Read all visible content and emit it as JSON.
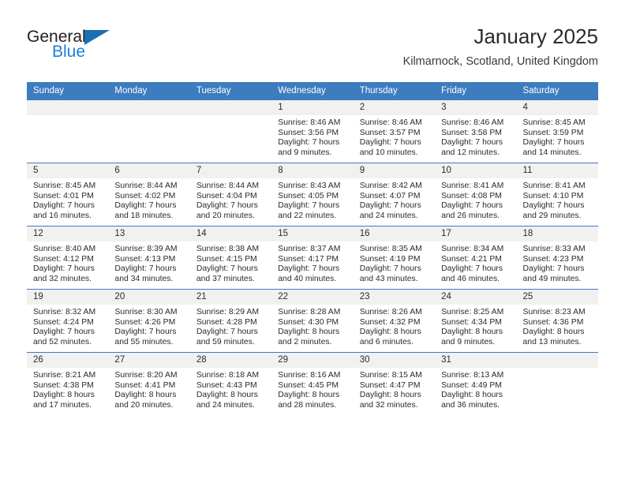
{
  "brand": {
    "line1": "General",
    "line2": "Blue",
    "triangle_color": "#1a6fb5",
    "blue_color": "#1a7fd4"
  },
  "header": {
    "title": "January 2025",
    "location": "Kilmarnock, Scotland, United Kingdom"
  },
  "theme": {
    "header_blue": "#3c7cbf",
    "daynum_band": "#f1f1f1",
    "text": "#2b2b2b"
  },
  "calendar": {
    "weekday_headers": [
      "Sunday",
      "Monday",
      "Tuesday",
      "Wednesday",
      "Thursday",
      "Friday",
      "Saturday"
    ],
    "weeks": [
      [
        {
          "day": "",
          "sunrise": "",
          "sunset": "",
          "daylight1": "",
          "daylight2": ""
        },
        {
          "day": "",
          "sunrise": "",
          "sunset": "",
          "daylight1": "",
          "daylight2": ""
        },
        {
          "day": "",
          "sunrise": "",
          "sunset": "",
          "daylight1": "",
          "daylight2": ""
        },
        {
          "day": "1",
          "sunrise": "Sunrise: 8:46 AM",
          "sunset": "Sunset: 3:56 PM",
          "daylight1": "Daylight: 7 hours",
          "daylight2": "and 9 minutes."
        },
        {
          "day": "2",
          "sunrise": "Sunrise: 8:46 AM",
          "sunset": "Sunset: 3:57 PM",
          "daylight1": "Daylight: 7 hours",
          "daylight2": "and 10 minutes."
        },
        {
          "day": "3",
          "sunrise": "Sunrise: 8:46 AM",
          "sunset": "Sunset: 3:58 PM",
          "daylight1": "Daylight: 7 hours",
          "daylight2": "and 12 minutes."
        },
        {
          "day": "4",
          "sunrise": "Sunrise: 8:45 AM",
          "sunset": "Sunset: 3:59 PM",
          "daylight1": "Daylight: 7 hours",
          "daylight2": "and 14 minutes."
        }
      ],
      [
        {
          "day": "5",
          "sunrise": "Sunrise: 8:45 AM",
          "sunset": "Sunset: 4:01 PM",
          "daylight1": "Daylight: 7 hours",
          "daylight2": "and 16 minutes."
        },
        {
          "day": "6",
          "sunrise": "Sunrise: 8:44 AM",
          "sunset": "Sunset: 4:02 PM",
          "daylight1": "Daylight: 7 hours",
          "daylight2": "and 18 minutes."
        },
        {
          "day": "7",
          "sunrise": "Sunrise: 8:44 AM",
          "sunset": "Sunset: 4:04 PM",
          "daylight1": "Daylight: 7 hours",
          "daylight2": "and 20 minutes."
        },
        {
          "day": "8",
          "sunrise": "Sunrise: 8:43 AM",
          "sunset": "Sunset: 4:05 PM",
          "daylight1": "Daylight: 7 hours",
          "daylight2": "and 22 minutes."
        },
        {
          "day": "9",
          "sunrise": "Sunrise: 8:42 AM",
          "sunset": "Sunset: 4:07 PM",
          "daylight1": "Daylight: 7 hours",
          "daylight2": "and 24 minutes."
        },
        {
          "day": "10",
          "sunrise": "Sunrise: 8:41 AM",
          "sunset": "Sunset: 4:08 PM",
          "daylight1": "Daylight: 7 hours",
          "daylight2": "and 26 minutes."
        },
        {
          "day": "11",
          "sunrise": "Sunrise: 8:41 AM",
          "sunset": "Sunset: 4:10 PM",
          "daylight1": "Daylight: 7 hours",
          "daylight2": "and 29 minutes."
        }
      ],
      [
        {
          "day": "12",
          "sunrise": "Sunrise: 8:40 AM",
          "sunset": "Sunset: 4:12 PM",
          "daylight1": "Daylight: 7 hours",
          "daylight2": "and 32 minutes."
        },
        {
          "day": "13",
          "sunrise": "Sunrise: 8:39 AM",
          "sunset": "Sunset: 4:13 PM",
          "daylight1": "Daylight: 7 hours",
          "daylight2": "and 34 minutes."
        },
        {
          "day": "14",
          "sunrise": "Sunrise: 8:38 AM",
          "sunset": "Sunset: 4:15 PM",
          "daylight1": "Daylight: 7 hours",
          "daylight2": "and 37 minutes."
        },
        {
          "day": "15",
          "sunrise": "Sunrise: 8:37 AM",
          "sunset": "Sunset: 4:17 PM",
          "daylight1": "Daylight: 7 hours",
          "daylight2": "and 40 minutes."
        },
        {
          "day": "16",
          "sunrise": "Sunrise: 8:35 AM",
          "sunset": "Sunset: 4:19 PM",
          "daylight1": "Daylight: 7 hours",
          "daylight2": "and 43 minutes."
        },
        {
          "day": "17",
          "sunrise": "Sunrise: 8:34 AM",
          "sunset": "Sunset: 4:21 PM",
          "daylight1": "Daylight: 7 hours",
          "daylight2": "and 46 minutes."
        },
        {
          "day": "18",
          "sunrise": "Sunrise: 8:33 AM",
          "sunset": "Sunset: 4:23 PM",
          "daylight1": "Daylight: 7 hours",
          "daylight2": "and 49 minutes."
        }
      ],
      [
        {
          "day": "19",
          "sunrise": "Sunrise: 8:32 AM",
          "sunset": "Sunset: 4:24 PM",
          "daylight1": "Daylight: 7 hours",
          "daylight2": "and 52 minutes."
        },
        {
          "day": "20",
          "sunrise": "Sunrise: 8:30 AM",
          "sunset": "Sunset: 4:26 PM",
          "daylight1": "Daylight: 7 hours",
          "daylight2": "and 55 minutes."
        },
        {
          "day": "21",
          "sunrise": "Sunrise: 8:29 AM",
          "sunset": "Sunset: 4:28 PM",
          "daylight1": "Daylight: 7 hours",
          "daylight2": "and 59 minutes."
        },
        {
          "day": "22",
          "sunrise": "Sunrise: 8:28 AM",
          "sunset": "Sunset: 4:30 PM",
          "daylight1": "Daylight: 8 hours",
          "daylight2": "and 2 minutes."
        },
        {
          "day": "23",
          "sunrise": "Sunrise: 8:26 AM",
          "sunset": "Sunset: 4:32 PM",
          "daylight1": "Daylight: 8 hours",
          "daylight2": "and 6 minutes."
        },
        {
          "day": "24",
          "sunrise": "Sunrise: 8:25 AM",
          "sunset": "Sunset: 4:34 PM",
          "daylight1": "Daylight: 8 hours",
          "daylight2": "and 9 minutes."
        },
        {
          "day": "25",
          "sunrise": "Sunrise: 8:23 AM",
          "sunset": "Sunset: 4:36 PM",
          "daylight1": "Daylight: 8 hours",
          "daylight2": "and 13 minutes."
        }
      ],
      [
        {
          "day": "26",
          "sunrise": "Sunrise: 8:21 AM",
          "sunset": "Sunset: 4:38 PM",
          "daylight1": "Daylight: 8 hours",
          "daylight2": "and 17 minutes."
        },
        {
          "day": "27",
          "sunrise": "Sunrise: 8:20 AM",
          "sunset": "Sunset: 4:41 PM",
          "daylight1": "Daylight: 8 hours",
          "daylight2": "and 20 minutes."
        },
        {
          "day": "28",
          "sunrise": "Sunrise: 8:18 AM",
          "sunset": "Sunset: 4:43 PM",
          "daylight1": "Daylight: 8 hours",
          "daylight2": "and 24 minutes."
        },
        {
          "day": "29",
          "sunrise": "Sunrise: 8:16 AM",
          "sunset": "Sunset: 4:45 PM",
          "daylight1": "Daylight: 8 hours",
          "daylight2": "and 28 minutes."
        },
        {
          "day": "30",
          "sunrise": "Sunrise: 8:15 AM",
          "sunset": "Sunset: 4:47 PM",
          "daylight1": "Daylight: 8 hours",
          "daylight2": "and 32 minutes."
        },
        {
          "day": "31",
          "sunrise": "Sunrise: 8:13 AM",
          "sunset": "Sunset: 4:49 PM",
          "daylight1": "Daylight: 8 hours",
          "daylight2": "and 36 minutes."
        },
        {
          "day": "",
          "sunrise": "",
          "sunset": "",
          "daylight1": "",
          "daylight2": ""
        }
      ]
    ]
  }
}
